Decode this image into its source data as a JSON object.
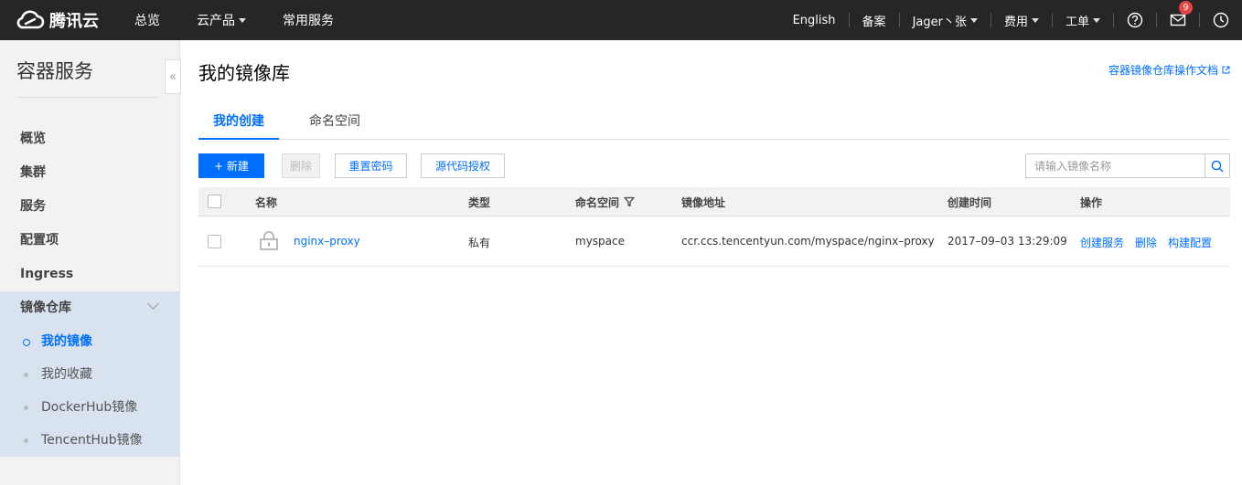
{
  "topbar": {
    "brand": "腾讯云",
    "nav_left": [
      {
        "label": "总览",
        "has_caret": false
      },
      {
        "label": "云产品",
        "has_caret": true
      },
      {
        "label": "常用服务",
        "has_caret": false
      }
    ],
    "nav_right": {
      "language": "English",
      "filing": "备案",
      "user": "Jager丶张",
      "billing": "费用",
      "ticket": "工单",
      "mail_badge": "9"
    },
    "icons": [
      "cloud-logo-icon",
      "help-icon",
      "mail-icon",
      "clock-icon"
    ]
  },
  "sidebar": {
    "title": "容器服务",
    "collapse": "«",
    "items": [
      "概览",
      "集群",
      "服务",
      "配置项",
      "Ingress"
    ],
    "group": {
      "label": "镜像仓库",
      "children": [
        {
          "label": "我的镜像",
          "active": true
        },
        {
          "label": "我的收藏",
          "active": false
        },
        {
          "label": "DockerHub镜像",
          "active": false
        },
        {
          "label": "TencentHub镜像",
          "active": false
        }
      ]
    }
  },
  "main": {
    "title": "我的镜像库",
    "doc_link": "容器镜像仓库操作文档",
    "tabs": [
      {
        "label": "我的创建",
        "active": true
      },
      {
        "label": "命名空间",
        "active": false
      }
    ],
    "toolbar": {
      "new": "+ 新建",
      "delete": "删除",
      "reset_password": "重置密码",
      "source_auth": "源代码授权",
      "search_placeholder": "请输入镜像名称"
    },
    "table": {
      "headers": {
        "name": "名称",
        "type": "类型",
        "namespace": "命名空间",
        "address": "镜像地址",
        "created": "创建时间",
        "actions": "操作"
      },
      "rows": [
        {
          "name": "nginx–proxy",
          "type": "私有",
          "namespace": "myspace",
          "address": "ccr.ccs.tencentyun.com/myspace/nginx–proxy",
          "created": "2017–09–03 13:29:09",
          "actions": [
            "创建服务",
            "删除",
            "构建配置"
          ]
        }
      ]
    }
  },
  "colors": {
    "accent": "#006eff",
    "topbar": "#262626",
    "sidebar": "#f2f2f2",
    "active_group": "#d9e3ef",
    "badge": "#e54545"
  }
}
